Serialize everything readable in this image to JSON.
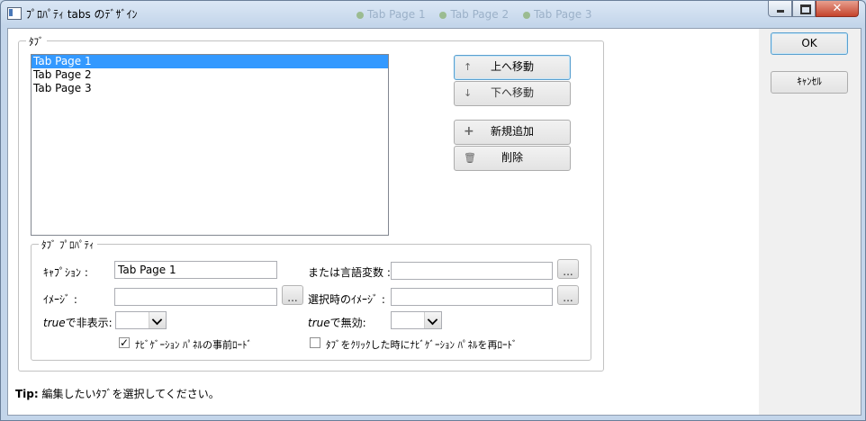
{
  "window": {
    "title": "ﾌﾟﾛﾊﾟﾃｨ tabs のﾃﾞｻﾞｲﾝ",
    "background_tabs": [
      "Tab Page 1",
      "Tab Page 2",
      "Tab Page 3"
    ]
  },
  "tabs_group": {
    "label": "ﾀﾌﾞ",
    "items": [
      "Tab Page 1",
      "Tab Page 2",
      "Tab Page 3"
    ],
    "selected_index": 0
  },
  "buttons": {
    "move_up": "上へ移動",
    "move_down": "下へ移動",
    "add_new": "新規追加",
    "delete": "削除",
    "ok": "OK",
    "cancel": "ｷｬﾝｾﾙ"
  },
  "properties": {
    "label": "ﾀﾌﾞ ﾌﾟﾛﾊﾟﾃｨ",
    "caption_label": "ｷｬﾌﾟｼｮﾝ :",
    "caption_value": "Tab Page 1",
    "var_label": "または言語変数 :",
    "var_value": "",
    "image_label": "ｲﾒｰｼﾞ :",
    "image_value": "",
    "selected_image_label": "選択時のｲﾒｰｼﾞ :",
    "selected_image_value": "",
    "hide_label_italic": "true",
    "hide_label_rest": "で非表示:",
    "hide_value": "",
    "disable_label_italic": "true",
    "disable_label_rest": "で無効:",
    "disable_value": "",
    "preload_label": "ﾅﾋﾞｹﾞｰｼｮﾝ ﾊﾟﾈﾙの事前ﾛｰﾄﾞ",
    "preload_checked": true,
    "reload_label": "ﾀﾌﾞをｸﾘｯｸした時にﾅﾋﾞｹﾞｰｼｮﾝ ﾊﾟﾈﾙを再ﾛｰﾄﾞ",
    "reload_checked": false,
    "ellipsis": "..."
  },
  "tip": {
    "prefix": "Tip:",
    "text": "編集したいﾀﾌﾞを選択してください。"
  }
}
